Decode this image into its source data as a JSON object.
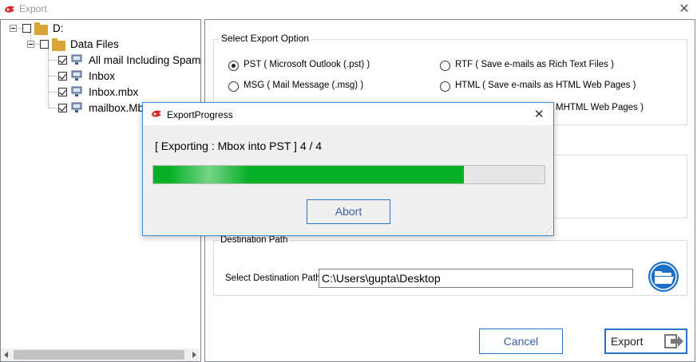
{
  "window": {
    "title": "Export",
    "close_glyph": "✕"
  },
  "tree": {
    "root": {
      "label": "D:",
      "checked": false
    },
    "folder": {
      "label": "Data Files",
      "checked": false
    },
    "items": [
      {
        "label": "All mail Including Spam",
        "checked": true
      },
      {
        "label": "Inbox",
        "checked": true
      },
      {
        "label": "Inbox.mbx",
        "checked": true
      },
      {
        "label": "mailbox.Mbox",
        "checked": true
      }
    ]
  },
  "export_options": {
    "title": "Select Export Option",
    "options": [
      {
        "label": "PST ( Microsoft Outlook (.pst) )",
        "selected": true
      },
      {
        "label": "RTF ( Save e-mails as Rich Text Files )",
        "selected": false
      },
      {
        "label": "MSG ( Mail Message (.msg) )",
        "selected": false
      },
      {
        "label": "HTML ( Save e-mails as HTML Web Pages )",
        "selected": false
      },
      {
        "label": "MHTML Web Pages )",
        "selected": false
      }
    ]
  },
  "destination": {
    "title": "Destination Path",
    "label": "Select Destination Path",
    "value": "C:\\Users\\gupta\\Desktop"
  },
  "buttons": {
    "cancel": "Cancel",
    "export": "Export"
  },
  "progress_dialog": {
    "title": "ExportProgress",
    "status": "[ Exporting : Mbox into PST ] 4 / 4",
    "progress_fraction": 0.793,
    "abort_label": "Abort",
    "close_glyph": "✕"
  },
  "colors": {
    "accent": "#2b73c9",
    "progress": "#06b025",
    "folder": "#d8a536"
  }
}
